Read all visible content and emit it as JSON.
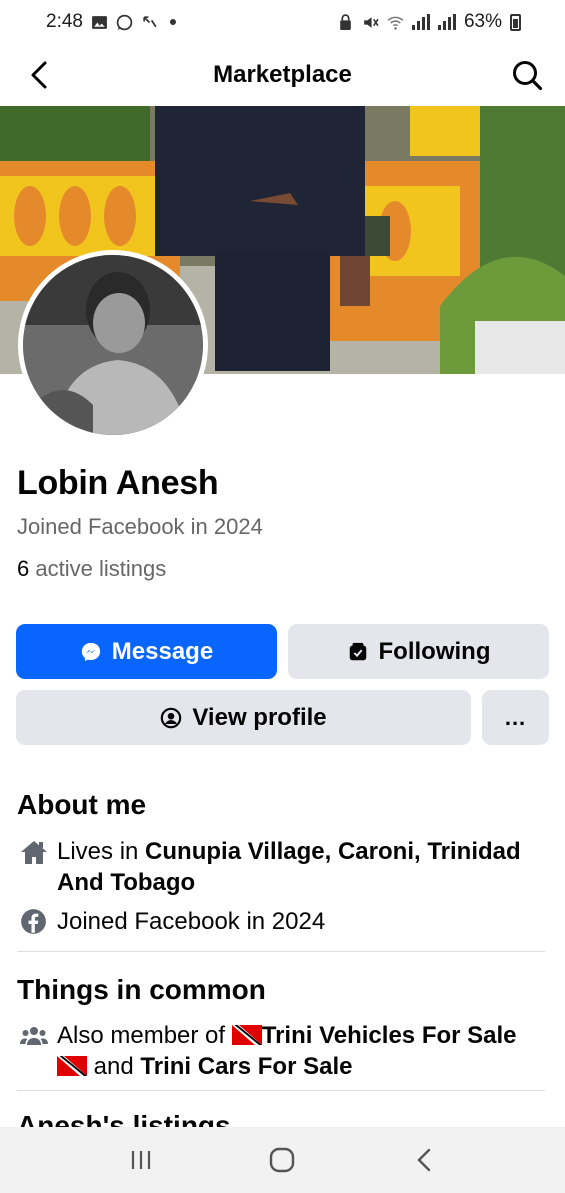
{
  "status_bar": {
    "time": "2:48",
    "battery": "63%"
  },
  "header": {
    "title": "Marketplace"
  },
  "profile": {
    "name": "Lobin Anesh",
    "joined": "Joined Facebook in 2024",
    "listings_count": "6",
    "listings_label": " active listings"
  },
  "actions": {
    "message": "Message",
    "following": "Following",
    "view_profile": "View profile",
    "more": "..."
  },
  "about": {
    "title": "About me",
    "lives_prefix": "Lives in ",
    "lives_place": "Cunupia Village, Caroni, Trinidad And Tobago",
    "joined": "Joined Facebook in 2024"
  },
  "common": {
    "title": "Things in common",
    "prefix": "Also member of ",
    "group1": "Trini Vehicles For Sale",
    "and": " and ",
    "group2": "Trini Cars For Sale"
  },
  "listings_section": {
    "title": "Anesh's listings"
  },
  "colors": {
    "primary": "#0866ff",
    "button_gray": "#e4e6eb",
    "secondary_text": "#65676b"
  },
  "icons": [
    "back-arrow-icon",
    "search-icon",
    "messenger-icon",
    "following-icon",
    "person-circle-icon",
    "house-icon",
    "facebook-icon",
    "group-icon",
    "trinidad-flag-icon",
    "recents-icon",
    "home-icon",
    "nav-back-icon"
  ]
}
